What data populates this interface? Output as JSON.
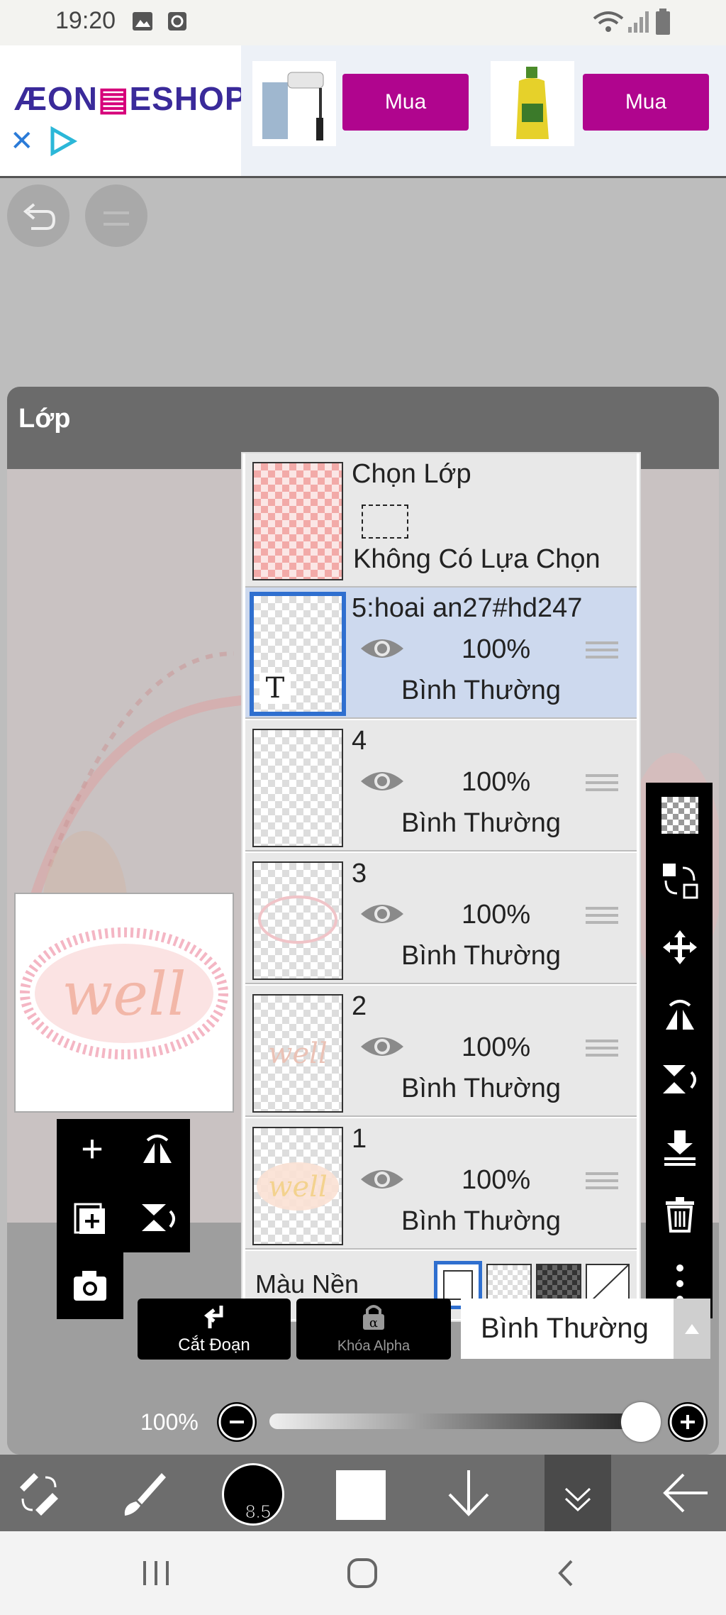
{
  "status_bar": {
    "time": "19:20"
  },
  "ad": {
    "brand": "ÆON",
    "brand_suffix": "ESHOP",
    "buy_button_1": "Mua",
    "buy_button_2": "Mua"
  },
  "panel": {
    "title": "Lớp"
  },
  "selection_row": {
    "title": "Chọn Lớp",
    "subtitle": "Không Có Lựa Chọn"
  },
  "layers": [
    {
      "name": "5:hoai an27#hd247",
      "opacity": "100%",
      "mode": "Bình Thường",
      "selected": true
    },
    {
      "name": "4",
      "opacity": "100%",
      "mode": "Bình Thường",
      "selected": false
    },
    {
      "name": "3",
      "opacity": "100%",
      "mode": "Bình Thường",
      "selected": false
    },
    {
      "name": "2",
      "opacity": "100%",
      "mode": "Bình Thường",
      "selected": false
    },
    {
      "name": "1",
      "opacity": "100%",
      "mode": "Bình Thường",
      "selected": false
    }
  ],
  "text_layer_marker": "T",
  "background_label": "Màu Nền",
  "preview_text": "well",
  "clip_label": "Cắt Đoạn",
  "alpha_lock_label": "Khóa Alpha",
  "blend_mode_value": "Bình Thường",
  "opacity_value": "100%",
  "brush_size": "8.5",
  "colors": {
    "accent": "#2f6fcf",
    "ad_button": "#b0058e",
    "selected_row": "#cdd9ee"
  }
}
